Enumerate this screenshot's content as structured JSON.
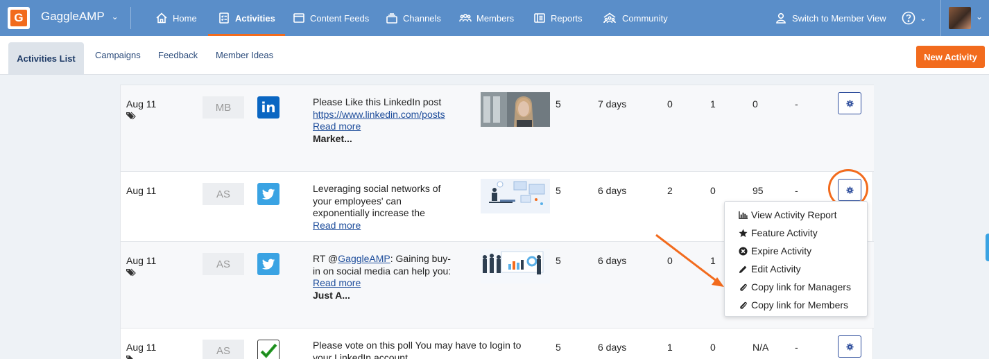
{
  "app": {
    "brand": "GaggleAMP"
  },
  "nav": {
    "items": [
      {
        "label": "Home",
        "icon": "home-icon"
      },
      {
        "label": "Activities",
        "icon": "checklist-icon",
        "active": true
      },
      {
        "label": "Content Feeds",
        "icon": "feed-icon"
      },
      {
        "label": "Channels",
        "icon": "stack-icon"
      },
      {
        "label": "Members",
        "icon": "people-icon"
      },
      {
        "label": "Reports",
        "icon": "report-icon"
      },
      {
        "label": "Community",
        "icon": "community-icon"
      }
    ],
    "switch_view": "Switch to Member View"
  },
  "subnav": {
    "tabs": [
      "Activities List",
      "Campaigns",
      "Feedback",
      "Member Ideas"
    ],
    "active_tab": "Activities List",
    "new_button": "New Activity"
  },
  "rows": [
    {
      "date": "Aug 11",
      "initials": "MB",
      "network": "linkedin",
      "text": "Please Like this LinkedIn post",
      "link": "https://www.linkedin.com/posts",
      "read_more": "Read more",
      "extra": "Market...",
      "col1": "5",
      "col2": "7 days",
      "col3": "0",
      "col4": "1",
      "col5": "0",
      "col6": "-"
    },
    {
      "date": "Aug 11",
      "initials": "AS",
      "network": "twitter",
      "text": "Leveraging social networks of your employees' can exponentially increase the",
      "read_more": "Read more",
      "col1": "5",
      "col2": "6 days",
      "col3": "2",
      "col4": "0",
      "col5": "95",
      "col6": "-"
    },
    {
      "date": "Aug 11",
      "initials": "AS",
      "network": "twitter",
      "text_prefix": "RT @",
      "mention": "GaggleAMP",
      "text_suffix": ": Gaining buy-in on social media can help you:",
      "read_more": "Read more",
      "extra": "Just A...",
      "col1": "5",
      "col2": "6 days",
      "col3": "0",
      "col4": "1"
    },
    {
      "date": "Aug 11",
      "initials": "AS",
      "network": "poll",
      "text": "Please vote on this poll You may have to login to your LinkedIn account",
      "col1": "5",
      "col2": "6 days",
      "col3": "1",
      "col4": "0",
      "col5": "N/A",
      "col6": "-"
    }
  ],
  "menu": {
    "items": [
      {
        "label": "View Activity Report",
        "icon": "bar-chart-icon"
      },
      {
        "label": "Feature Activity",
        "icon": "star-icon"
      },
      {
        "label": "Expire Activity",
        "icon": "times-circle-icon"
      },
      {
        "label": "Edit Activity",
        "icon": "pencil-icon"
      },
      {
        "label": "Copy link for Managers",
        "icon": "paperclip-icon"
      },
      {
        "label": "Copy link for Members",
        "icon": "paperclip-icon"
      }
    ]
  },
  "colors": {
    "nav_bg": "#5a8ec9",
    "accent": "#f26b1d",
    "link": "#1e4d9b"
  }
}
